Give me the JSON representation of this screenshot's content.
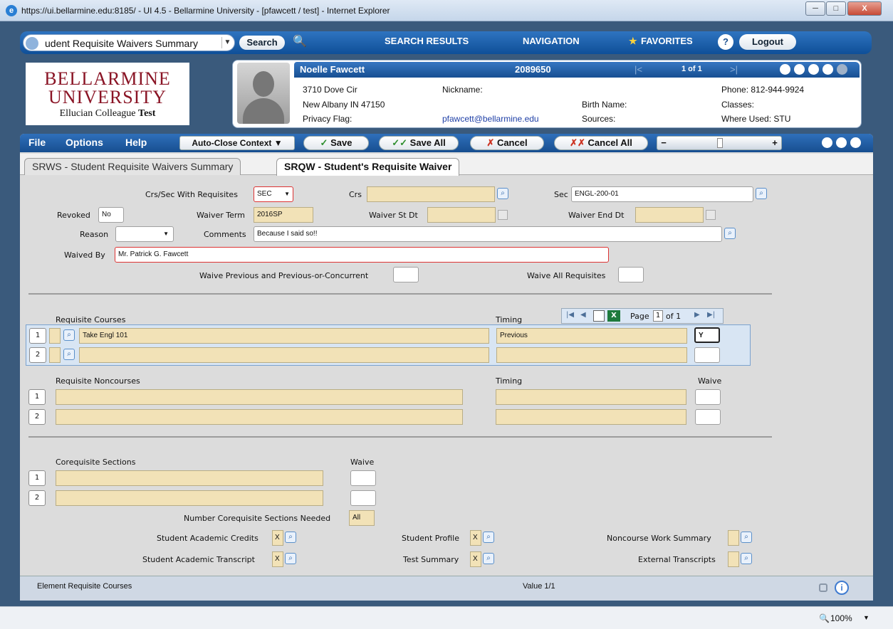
{
  "window": {
    "title": "https://ui.bellarmine.edu:8185/ - UI 4.5 - Bellarmine University - [pfawcett / test] - Internet Explorer",
    "ie_icon": "e",
    "minimize_label": "─",
    "maximize_label": "□",
    "close_label": "X"
  },
  "toolbar": {
    "search_combo_value": "udent Requisite Waivers Summary",
    "combo_arrow": "▼",
    "search_label": "Search",
    "zoom_icon": "🔍",
    "search_results_label": "SEARCH RESULTS",
    "navigation_label": "NAVIGATION",
    "favorites_label": "FAVORITES",
    "favorites_star": "★",
    "help_label": "?",
    "logout_label": "Logout"
  },
  "logo": {
    "line1": "BELLARMINE",
    "line2": "UNIVERSITY",
    "line3_a": "Ellucian Colleague ",
    "line3_b": "Test"
  },
  "person": {
    "name": "Noelle Fawcett",
    "id": "2089650",
    "nav_prev": "|<",
    "nav_next": ">|",
    "record_count": "1 of 1",
    "address1": "3710 Dove Cir",
    "address2": "New Albany IN 47150",
    "privacy_flag": "Privacy Flag:",
    "nickname": "Nickname:",
    "email": "pfawcett@bellarmine.edu",
    "birth_name": "Birth Name:",
    "sources": "Sources:",
    "phone": "Phone: 812-944-9924",
    "classes": "Classes:",
    "where_used": "Where Used: STU"
  },
  "menu": {
    "file": "File",
    "options": "Options",
    "help": "Help",
    "auto_close": "Auto-Close Context ▼",
    "save": "Save",
    "save_all": "Save All",
    "cancel": "Cancel",
    "cancel_all": "Cancel All",
    "save_glyph": "✓",
    "save_all_glyph": "✓✓",
    "cancel_glyph": "✗",
    "cancel_all_glyph": "✗✗",
    "minus": "−",
    "plus": "+"
  },
  "tabs": {
    "srws": "SRWS - Student Requisite Waivers Summary",
    "srqw": "SRQW - Student's Requisite Waiver"
  },
  "form": {
    "crs_sec_label": "Crs/Sec With Requisites",
    "crs_sec_value": "SEC",
    "crs_label": "Crs",
    "crs_value": "",
    "sec_label": "Sec",
    "sec_value": "ENGL-200-01",
    "revoked_label": "Revoked",
    "revoked_value": "No",
    "waiver_term_label": "Waiver Term",
    "waiver_term_value": "2016SP",
    "waiver_st_label": "Waiver St Dt",
    "waiver_st_value": "",
    "waiver_end_label": "Waiver End Dt",
    "waiver_end_value": "",
    "reason_label": "Reason",
    "reason_value": "",
    "comments_label": "Comments",
    "comments_value": "Because I said so!!",
    "waived_by_label": "Waived By",
    "waived_by_value": "Mr. Patrick G. Fawcett",
    "waive_prev_label": "Waive Previous and Previous-or-Concurrent",
    "waive_prev_value": "",
    "waive_all_label": "Waive All Requisites",
    "waive_all_value": ""
  },
  "req_courses": {
    "header": "Requisite Courses",
    "timing_header": "Timing",
    "pager_page": "Page",
    "pager_current": "1",
    "pager_of": "of 1",
    "rows": [
      {
        "num": "1",
        "course": "Take Engl 101",
        "timing": "Previous",
        "waive": "Y"
      },
      {
        "num": "2",
        "course": "",
        "timing": "",
        "waive": ""
      }
    ]
  },
  "req_noncourses": {
    "header": "Requisite Noncourses",
    "timing_header": "Timing",
    "waive_header": "Waive",
    "rows": [
      {
        "num": "1",
        "value": "",
        "timing": "",
        "waive": ""
      },
      {
        "num": "2",
        "value": "",
        "timing": "",
        "waive": ""
      }
    ]
  },
  "coreq": {
    "header": "Corequisite Sections",
    "waive_header": "Waive",
    "rows": [
      {
        "num": "1",
        "value": "",
        "waive": ""
      },
      {
        "num": "2",
        "value": "",
        "waive": ""
      }
    ],
    "needed_label": "Number Corequisite Sections Needed",
    "needed_value": "All"
  },
  "links": {
    "sac_label": "Student Academic Credits",
    "sac_value": "X",
    "sp_label": "Student Profile",
    "sp_value": "X",
    "nws_label": "Noncourse Work Summary",
    "nws_value": "",
    "sat_label": "Student Academic Transcript",
    "sat_value": "X",
    "ts_label": "Test Summary",
    "ts_value": "X",
    "et_label": "External Transcripts",
    "et_value": ""
  },
  "status": {
    "element": "Element Requisite Courses",
    "value": "Value 1/1",
    "info_glyph": "i"
  },
  "ie_status": {
    "zoom": "100%",
    "zoom_arrow": "▼"
  },
  "colors": {
    "brand_blue": "#174e90",
    "field_tan": "#f2e2b7",
    "logo_maroon": "#8a1425"
  }
}
